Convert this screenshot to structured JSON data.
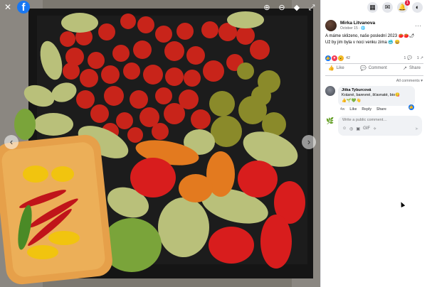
{
  "photo": {
    "alt": "",
    "nav_prev": "‹",
    "nav_next": "›",
    "close": "✕",
    "fb_logo": "f",
    "tools": [
      "⊕",
      "⊖",
      "◆",
      "⤢"
    ]
  },
  "topbar": {
    "icons": [
      {
        "name": "menu-grid-icon",
        "glyph": "▦",
        "badge": ""
      },
      {
        "name": "messenger-icon",
        "glyph": "✉",
        "badge": ""
      },
      {
        "name": "notifications-icon",
        "glyph": "🔔",
        "badge": "1"
      },
      {
        "name": "account-icon",
        "glyph": "◐",
        "badge": ""
      }
    ]
  },
  "post": {
    "author": "Mirka Litvanova",
    "date": "October 15 · ",
    "date_icon": "🌐",
    "text_line1": "A máme sklizeno, naše poslední 2023 🍅🍅🌶",
    "text_line2": "Už by jim byla v noci venku zima 🥶 😄",
    "reaction_count": "42",
    "comment_count": "1",
    "share_count": "1",
    "comment_glyph": "💬",
    "share_glyph": "↗",
    "more": "···"
  },
  "actions": {
    "like": "Like",
    "comment": "Comment",
    "share": "Share"
  },
  "comments": {
    "filter": "All comments ▾",
    "items": [
      {
        "name": "Jitka Tyburcová",
        "text": "Krásné, barevné, šťavnaté, bio😋",
        "emojis": "👍🌱💚👋",
        "time": "4w",
        "like": "Like",
        "reply": "Reply",
        "share": "Share"
      }
    ]
  },
  "composer": {
    "placeholder": "Write a public comment…",
    "tools": [
      "☺",
      "◎",
      "▣",
      "GIF",
      "✧"
    ],
    "send": "➤"
  },
  "colors": {
    "accent": "#1877f2",
    "text": "#050505",
    "muted": "#65676b"
  }
}
